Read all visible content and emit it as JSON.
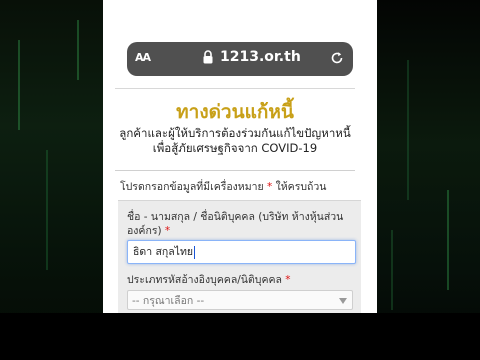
{
  "browser": {
    "text_size_label": "AA",
    "url": "1213.or.th"
  },
  "header": {
    "title": "ทางด่วนแก้หนี้",
    "subtitle_line1": "ลูกค้าและผู้ให้บริการต้องร่วมกันแก้ไขปัญหาหนี้",
    "subtitle_line2": "เพื่อสู้ภัยเศรษฐกิจจาก COVID-19"
  },
  "form": {
    "instruction_prefix": "โปรดกรอกข้อมูลที่มีเครื่องหมาย",
    "required_mark": "*",
    "instruction_suffix": "ให้ครบถ้วน",
    "name_label": "ชื่อ - นามสกุล / ชื่อนิติบุคคล (บริษัท ห้างหุ้นส่วน องค์กร)",
    "name_value": "ธิดา สกุลไทย",
    "id_type_label": "ประเภทรหัสอ้างอิงบุคคล/นิติบุคคล",
    "id_type_selected": "-- กรุณาเลือก --"
  },
  "colors": {
    "title_gold": "#c8a018",
    "required_red": "#dd1111",
    "input_focus": "#8ab4f8"
  }
}
